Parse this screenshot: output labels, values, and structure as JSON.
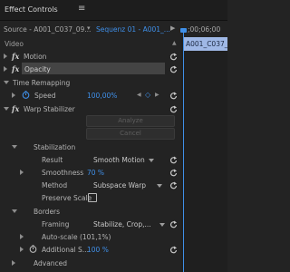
{
  "panel": {
    "title": "Effect Controls",
    "menu_icon": "hamburger-menu-icon"
  },
  "header": {
    "source_label": "Source - A001_C037_09...",
    "sequence_label": "Sequenz 01 - A001_...",
    "timecode": ";00;06;00",
    "clip_label": "A001_C037_"
  },
  "sections": {
    "video": "Video"
  },
  "effects": {
    "motion": "Motion",
    "opacity": "Opacity",
    "time_remapping": "Time Remapping",
    "speed_label": "Speed",
    "speed_value": "100,00%",
    "warp": "Warp Stabilizer",
    "analyze": "Analyze",
    "cancel": "Cancel"
  },
  "stabilization": {
    "heading": "Stabilization",
    "result_label": "Result",
    "result_value": "Smooth Motion",
    "smoothness_label": "Smoothness",
    "smoothness_value": "70 %",
    "method_label": "Method",
    "method_value": "Subspace Warp",
    "preserve_label": "Preserve Scale"
  },
  "borders": {
    "heading": "Borders",
    "framing_label": "Framing",
    "framing_value": "Stabilize, Crop,...",
    "autoscale_label": "Auto-scale (101,1%)",
    "additional_label": "Additional S...",
    "additional_value": "100 %"
  },
  "advanced": {
    "heading": "Advanced"
  },
  "colors": {
    "bg": "#232323",
    "accent": "#3f8fe8",
    "text": "#b4b4b4"
  }
}
